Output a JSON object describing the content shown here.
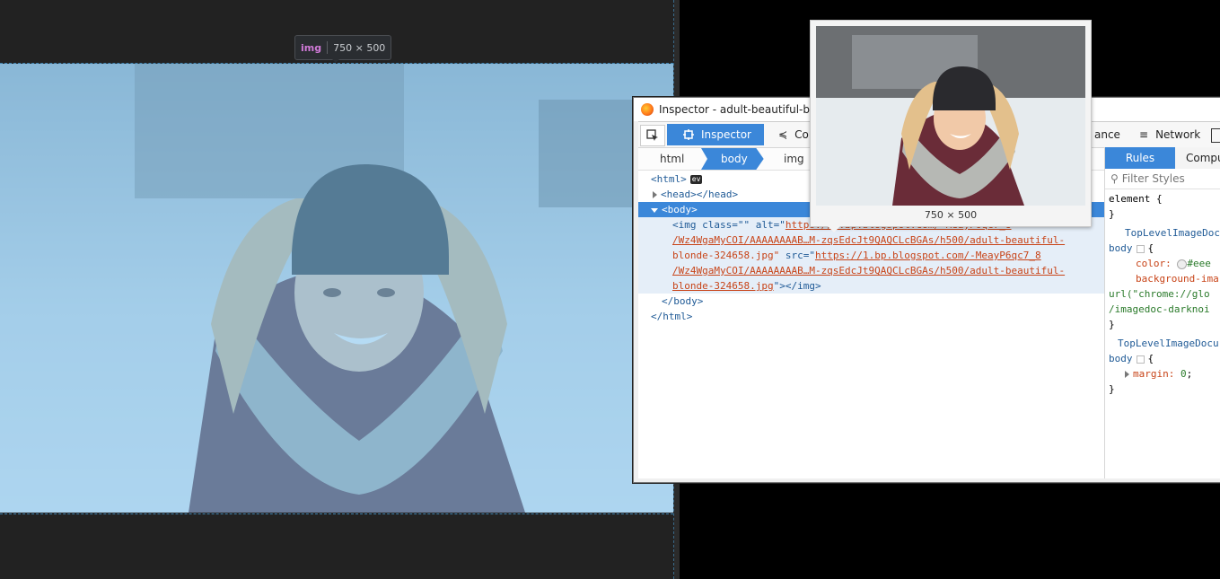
{
  "viewport": {
    "tooltip": {
      "tag": "img",
      "size": "750 × 500"
    }
  },
  "inspector": {
    "window_title": "Inspector - adult-beautiful-blon",
    "toolbar": {
      "inspector_tab": "Inspector",
      "console_tab": "Co",
      "performance_tab_fragment": "ance",
      "network_tab": "Network"
    },
    "breadcrumbs": [
      "html",
      "body",
      "img"
    ],
    "markup": {
      "html_open": "<html>",
      "ev_badge": "ev",
      "head": "<head></head>",
      "body_open": "<body>",
      "img_line1_a": "<img class=\"\" alt=\"",
      "img_line1_b": "https://1.bp.blogspot.com/-MeayP6qc7_8",
      "img_line2": "/Wz4WgaMyCOI/AAAAAAAAB…M-zqsEdcJt9QAQCLcBGAs/h500/adult-beautiful-",
      "img_line3_a": "blonde-324658.jpg\"",
      "img_line3_b": " src=\"",
      "img_line3_c": "https://1.bp.blogspot.com/-MeayP6qc7_8",
      "img_line4": "/Wz4WgaMyCOI/AAAAAAAAB…M-zqsEdcJt9QAQCLcBGAs/h500/adult-beautiful-",
      "img_line5_a": "blonde-324658.jpg",
      "img_line5_b": "\"></img>",
      "body_close": "</body>",
      "html_close": "</html>"
    },
    "rules": {
      "rules_tab": "Rules",
      "computed_tab": "Compu",
      "filter_placeholder": "Filter Styles",
      "element_rule": "element {",
      "close_brace": "}",
      "source1": "TopLevelImageDoc",
      "selector_body": "body",
      "open_brace": "{",
      "color_prop": "color:",
      "color_val": "#eee",
      "bg_prop": "background-ima",
      "bg_val1": "url(\"chrome://glo",
      "bg_val2": "/imagedoc-darknoi",
      "source2": "TopLevelImageDocu",
      "margin_prop": "margin:",
      "margin_val": "0",
      "semicolon": ";"
    },
    "preview": {
      "caption": "750 × 500"
    }
  },
  "icons": {
    "picker": "element-picker-icon",
    "inspector": "inspector-icon",
    "console": "console-icon",
    "network": "network-icon",
    "search": "search-icon",
    "browser": "firefox-logo-icon"
  },
  "colors": {
    "accent": "#3b87d9",
    "viewport_bg": "#222222",
    "overlay": "#78bee6"
  }
}
